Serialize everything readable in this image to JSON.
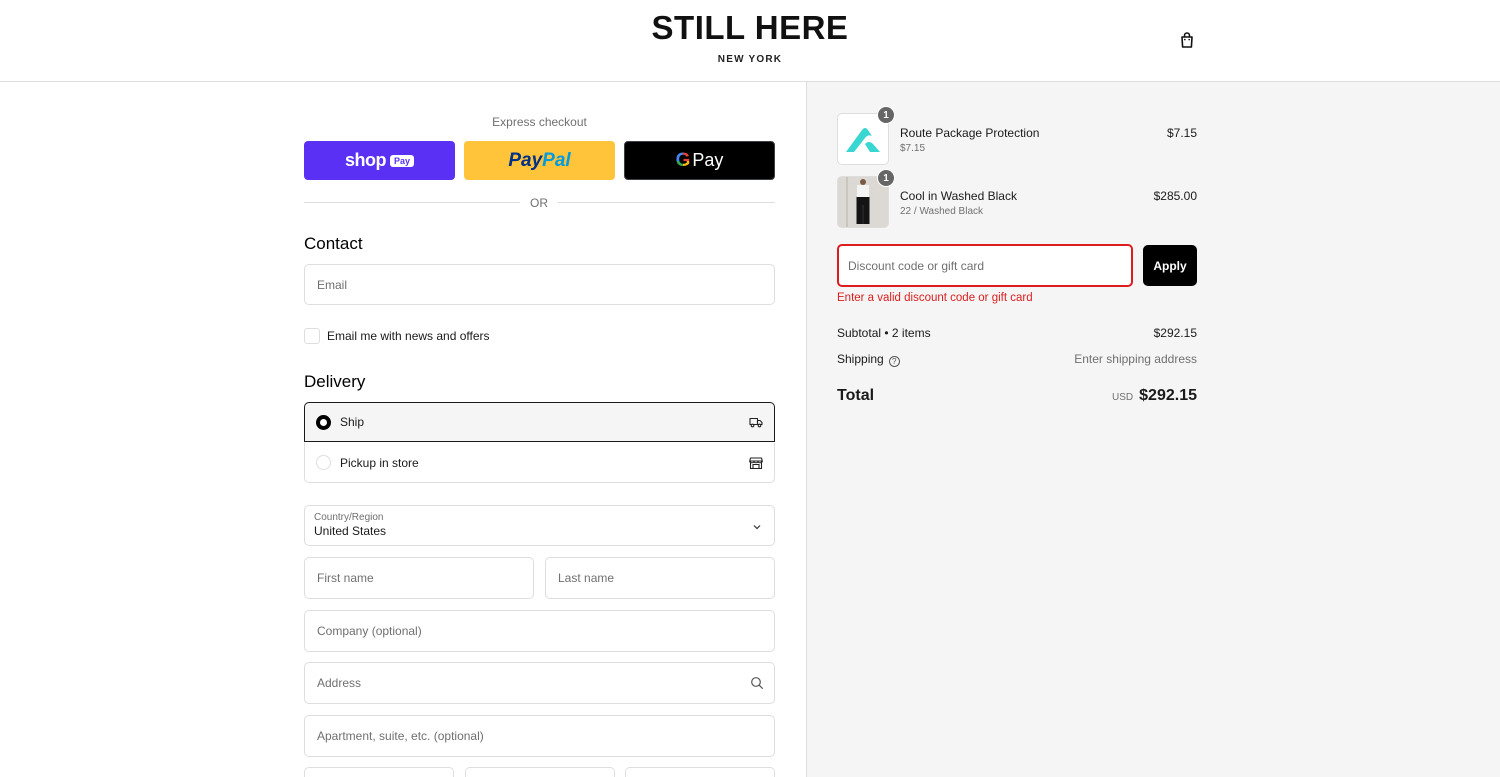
{
  "header": {
    "logo_main": "STILL HERE",
    "logo_sub": "NEW YORK",
    "cart_icon": "shopping-bag-icon"
  },
  "express": {
    "label": "Express checkout",
    "shoppay_text": "shop",
    "shoppay_pill": "Pay",
    "paypal_part1": "Pay",
    "paypal_part2": "Pal",
    "gpay_g": "G",
    "gpay_text": "Pay",
    "or_text": "OR"
  },
  "contact": {
    "title": "Contact",
    "email_placeholder": "Email",
    "newsletter_label": "Email me with news and offers"
  },
  "delivery": {
    "title": "Delivery",
    "options": [
      {
        "label": "Ship",
        "selected": true,
        "icon": "truck-icon"
      },
      {
        "label": "Pickup in store",
        "selected": false,
        "icon": "store-icon"
      }
    ],
    "country_label": "Country/Region",
    "country_value": "United States",
    "first_name_placeholder": "First name",
    "last_name_placeholder": "Last name",
    "company_placeholder": "Company (optional)",
    "address_placeholder": "Address",
    "apartment_placeholder": "Apartment, suite, etc. (optional)"
  },
  "summary": {
    "items": [
      {
        "name": "Route Package Protection",
        "sub": "$7.15",
        "price": "$7.15",
        "qty": "1"
      },
      {
        "name": "Cool in Washed Black",
        "sub": "22 / Washed Black",
        "price": "$285.00",
        "qty": "1"
      }
    ],
    "discount_placeholder": "Discount code or gift card",
    "apply_label": "Apply",
    "error": "Enter a valid discount code or gift card",
    "subtotal_label": "Subtotal • 2 items",
    "subtotal_value": "$292.15",
    "shipping_label": "Shipping",
    "shipping_value": "Enter shipping address",
    "total_label": "Total",
    "total_currency": "USD",
    "total_value": "$292.15"
  },
  "colors": {
    "shoppay": "#5a31f4",
    "paypal": "#ffc439",
    "error": "#dd1d1d"
  }
}
